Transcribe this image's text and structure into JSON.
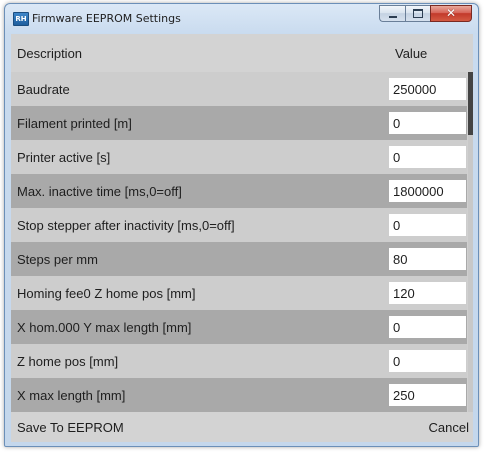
{
  "window": {
    "title": "Firmware EEPROM Settings",
    "icon": "printer-app-icon",
    "icon_glyph": "RH"
  },
  "table": {
    "header": {
      "description": "Description",
      "value": "Value"
    },
    "rows": [
      {
        "label": "Baudrate",
        "value": "250000"
      },
      {
        "label": "Filament printed [m]",
        "value": "0"
      },
      {
        "label": "Printer active [s]",
        "value": "0"
      },
      {
        "label": "Max. inactive time [ms,0=off]",
        "value": "1800000"
      },
      {
        "label": "Stop stepper after inactivity [ms,0=off]",
        "value": "0"
      },
      {
        "label": "Steps per mm",
        "value": "80"
      },
      {
        "label": "Homing fee0 Z home pos [mm]",
        "value": "120"
      },
      {
        "label": "X hom.000 Y max length [mm]",
        "value": "0"
      },
      {
        "label": "Z home pos [mm]",
        "value": "0"
      },
      {
        "label": "X max length [mm]",
        "value": "250"
      }
    ],
    "row_colors": {
      "light": "#cdcdcd",
      "dark": "#a9a9a9"
    }
  },
  "footer": {
    "save_label": "Save To EEPROM",
    "cancel_label": "Cancel"
  },
  "colors": {
    "close_button": "#c2392b",
    "scroll_thumb": "#444444"
  }
}
